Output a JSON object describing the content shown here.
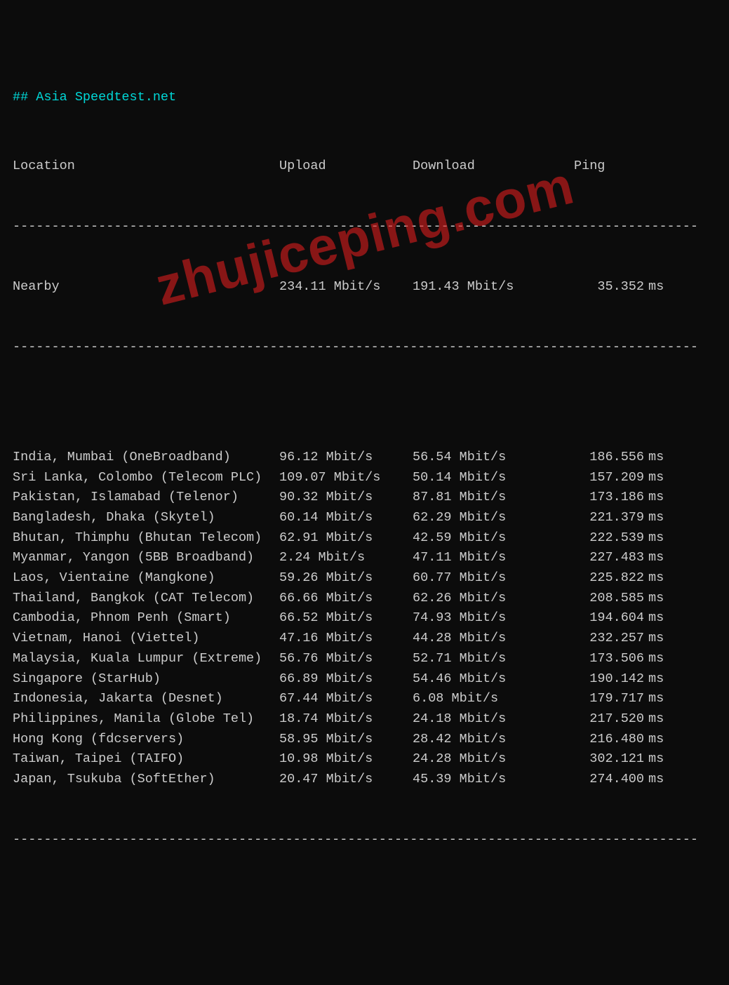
{
  "title": "## Asia Speedtest.net",
  "headers": {
    "location": "Location",
    "upload": "Upload",
    "download": "Download",
    "ping": "Ping"
  },
  "dash_line": "----------------------------------------------------------------------------------------",
  "nearby": {
    "location": "Nearby",
    "upload": "234.11 Mbit/s",
    "download": "191.43 Mbit/s",
    "ping": "35.352",
    "unit": "ms"
  },
  "rows": [
    {
      "location": "India, Mumbai (OneBroadband)",
      "upload": "96.12 Mbit/s",
      "download": "56.54 Mbit/s",
      "ping": "186.556",
      "unit": "ms"
    },
    {
      "location": "Sri Lanka, Colombo (Telecom PLC)",
      "upload": "109.07 Mbit/s",
      "download": "50.14 Mbit/s",
      "ping": "157.209",
      "unit": "ms"
    },
    {
      "location": "Pakistan, Islamabad (Telenor)",
      "upload": "90.32 Mbit/s",
      "download": "87.81 Mbit/s",
      "ping": "173.186",
      "unit": "ms"
    },
    {
      "location": "Bangladesh, Dhaka (Skytel)",
      "upload": "60.14 Mbit/s",
      "download": "62.29 Mbit/s",
      "ping": "221.379",
      "unit": "ms"
    },
    {
      "location": "Bhutan, Thimphu (Bhutan Telecom)",
      "upload": "62.91 Mbit/s",
      "download": "42.59 Mbit/s",
      "ping": "222.539",
      "unit": "ms"
    },
    {
      "location": "Myanmar, Yangon (5BB Broadband)",
      "upload": "2.24 Mbit/s",
      "download": "47.11 Mbit/s",
      "ping": "227.483",
      "unit": "ms"
    },
    {
      "location": "Laos, Vientaine (Mangkone)",
      "upload": "59.26 Mbit/s",
      "download": "60.77 Mbit/s",
      "ping": "225.822",
      "unit": "ms"
    },
    {
      "location": "Thailand, Bangkok (CAT Telecom)",
      "upload": "66.66 Mbit/s",
      "download": "62.26 Mbit/s",
      "ping": "208.585",
      "unit": "ms"
    },
    {
      "location": "Cambodia, Phnom Penh (Smart)",
      "upload": "66.52 Mbit/s",
      "download": "74.93 Mbit/s",
      "ping": "194.604",
      "unit": "ms"
    },
    {
      "location": "Vietnam, Hanoi (Viettel)",
      "upload": "47.16 Mbit/s",
      "download": "44.28 Mbit/s",
      "ping": "232.257",
      "unit": "ms"
    },
    {
      "location": "Malaysia, Kuala Lumpur (Extreme)",
      "upload": "56.76 Mbit/s",
      "download": "52.71 Mbit/s",
      "ping": "173.506",
      "unit": "ms"
    },
    {
      "location": "Singapore (StarHub)",
      "upload": "66.89 Mbit/s",
      "download": "54.46 Mbit/s",
      "ping": "190.142",
      "unit": "ms"
    },
    {
      "location": "Indonesia, Jakarta (Desnet)",
      "upload": "67.44 Mbit/s",
      "download": "6.08 Mbit/s",
      "ping": "179.717",
      "unit": "ms"
    },
    {
      "location": "Philippines, Manila (Globe Tel)",
      "upload": "18.74 Mbit/s",
      "download": "24.18 Mbit/s",
      "ping": "217.520",
      "unit": "ms"
    },
    {
      "location": "Hong Kong (fdcservers)",
      "upload": "58.95 Mbit/s",
      "download": "28.42 Mbit/s",
      "ping": "216.480",
      "unit": "ms"
    },
    {
      "location": "Taiwan, Taipei (TAIFO)",
      "upload": "10.98 Mbit/s",
      "download": "24.28 Mbit/s",
      "ping": "302.121",
      "unit": "ms"
    },
    {
      "location": "Japan, Tsukuba (SoftEther)",
      "upload": "20.47 Mbit/s",
      "download": "45.39 Mbit/s",
      "ping": "274.400",
      "unit": "ms"
    }
  ],
  "watermark": "zhujiceping.com"
}
